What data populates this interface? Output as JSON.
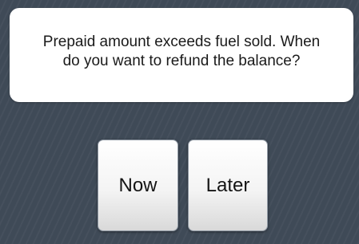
{
  "dialog": {
    "message": "Prepaid amount exceeds fuel sold. When do you want to refund the balance?",
    "buttons": {
      "now_label": "Now",
      "later_label": "Later"
    }
  },
  "colors": {
    "background": "#3f4a57",
    "panel": "#ffffff",
    "text": "#1a1a1a"
  }
}
